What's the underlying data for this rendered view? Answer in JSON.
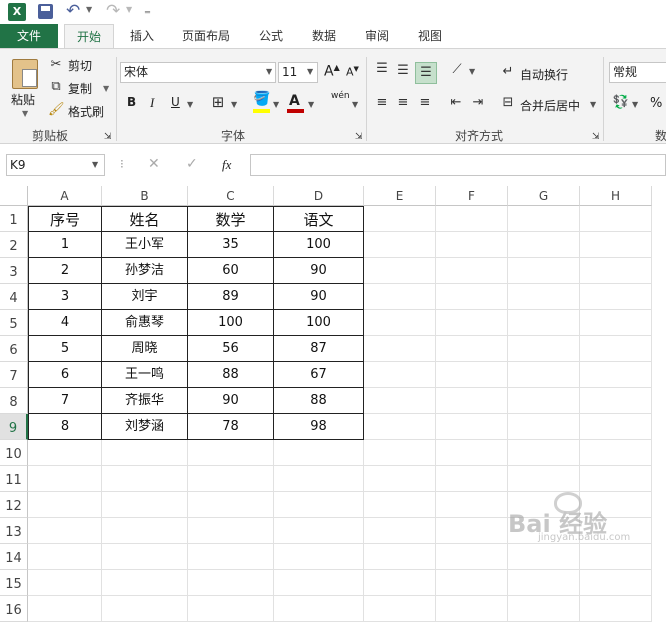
{
  "app": {
    "icon": "excel-icon"
  },
  "qat": {
    "save": "save-icon",
    "undo": "undo-icon",
    "redo": "redo-icon",
    "customize": "chevron-down-icon"
  },
  "tabs": [
    "文件",
    "开始",
    "插入",
    "页面布局",
    "公式",
    "数据",
    "审阅",
    "视图"
  ],
  "clipboard": {
    "paste": "粘贴",
    "cut": "剪切",
    "copy": "复制",
    "format_painter": "格式刷",
    "label": "剪贴板"
  },
  "font": {
    "name": "宋体",
    "size": "11",
    "bold": "B",
    "italic": "I",
    "underline": "U",
    "grow": "A",
    "shrink": "A",
    "phonetic": "wén",
    "label": "字体",
    "highlight_color": "#ffff00",
    "font_color": "#c00000"
  },
  "alignment": {
    "wrap": "自动换行",
    "merge": "合并后居中",
    "label": "对齐方式"
  },
  "number": {
    "format": "常规",
    "percent": "%",
    "label": "数"
  },
  "formula_bar": {
    "name_box": "K9",
    "fx": "fx"
  },
  "columns": [
    "A",
    "B",
    "C",
    "D",
    "E",
    "F",
    "G",
    "H"
  ],
  "rows": [
    "1",
    "2",
    "3",
    "4",
    "5",
    "6",
    "7",
    "8",
    "9",
    "10",
    "11",
    "12",
    "13",
    "14",
    "15",
    "16"
  ],
  "selected_row": "9",
  "table": {
    "headers": [
      "序号",
      "姓名",
      "数学",
      "语文"
    ],
    "rows": [
      [
        "1",
        "王小军",
        "35",
        "100"
      ],
      [
        "2",
        "孙梦洁",
        "60",
        "90"
      ],
      [
        "3",
        "刘宇",
        "89",
        "90"
      ],
      [
        "4",
        "俞惠琴",
        "100",
        "100"
      ],
      [
        "5",
        "周晓",
        "56",
        "87"
      ],
      [
        "6",
        "王一鸣",
        "88",
        "67"
      ],
      [
        "7",
        "齐振华",
        "90",
        "88"
      ],
      [
        "8",
        "刘梦涵",
        "78",
        "98"
      ]
    ]
  },
  "watermark": {
    "text": "Bai 经验",
    "sub": "jingyan.baidu.com"
  }
}
